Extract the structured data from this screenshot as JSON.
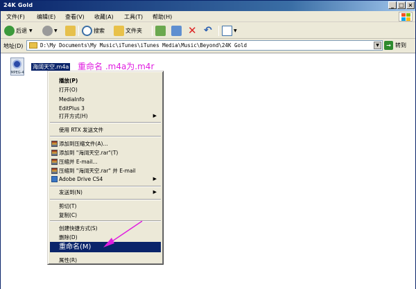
{
  "window": {
    "title": "24K Gold"
  },
  "menubar": {
    "items": [
      "文件(F)",
      "编辑(E)",
      "查看(V)",
      "收藏(A)",
      "工具(T)",
      "帮助(H)"
    ]
  },
  "toolbar": {
    "back": "后退",
    "search": "搜索",
    "folders": "文件夹"
  },
  "address": {
    "label": "地址(D)",
    "path": "D:\\My Documents\\My Music\\iTunes\\iTunes Media\\Music\\Beyond\\24K Gold",
    "go": "转到"
  },
  "file": {
    "name": "海阔天空.m4a",
    "badge": "MPEG-4"
  },
  "annotation": "重命名 .m4a为.m4r",
  "context_menu": {
    "items": [
      "播放(P)",
      "打开(O)",
      "MediaInfo",
      "EditPlus 3",
      "打开方式(H)",
      "使用 RTX 发送文件",
      "添加到压缩文件(A)...",
      "添加到 \"海阔天空.rar\"(T)",
      "压缩并 E-mail...",
      "压缩到 \"海阔天空.rar\" 并 E-mail",
      "Adobe Drive CS4",
      "发送到(N)",
      "剪切(T)",
      "复制(C)",
      "创建快捷方式(S)",
      "删除(D)",
      "重命名(M)",
      "属性(R)"
    ]
  },
  "colors": {
    "title_gradient_start": "#0a246a",
    "selection": "#0a246a",
    "annotation": "#e01ee0"
  }
}
